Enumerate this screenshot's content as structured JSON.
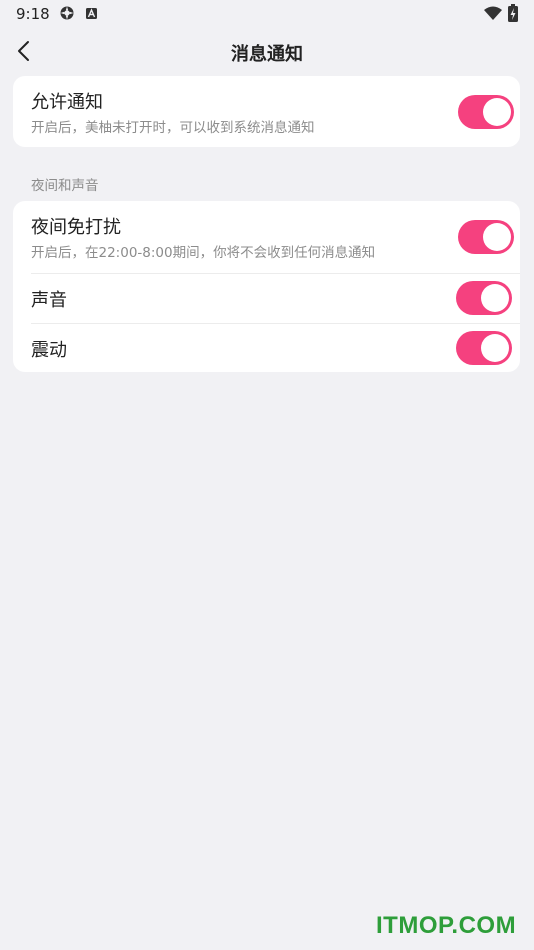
{
  "status_bar": {
    "time": "9:18",
    "icons": [
      "settings-gear-icon",
      "a-letter-icon",
      "wifi-icon",
      "battery-charging-icon"
    ]
  },
  "nav": {
    "back_icon": "chevron-left-icon",
    "title": "消息通知"
  },
  "allow_section": {
    "title": "允许通知",
    "description": "开启后，美柚未打开时，可以收到系统消息通知",
    "toggle_on": true
  },
  "night_section": {
    "header": "夜间和声音",
    "items": [
      {
        "title": "夜间免打扰",
        "description": "开启后，在22:00-8:00期间，你将不会收到任何消息通知",
        "toggle_on": true
      },
      {
        "title": "声音",
        "toggle_on": true
      },
      {
        "title": "震动",
        "toggle_on": true
      }
    ]
  },
  "watermark": "ITMOP.COM",
  "colors": {
    "background": "#f1f1f4",
    "toggle_on": "#f5417f",
    "watermark": "#2e9e3a"
  }
}
